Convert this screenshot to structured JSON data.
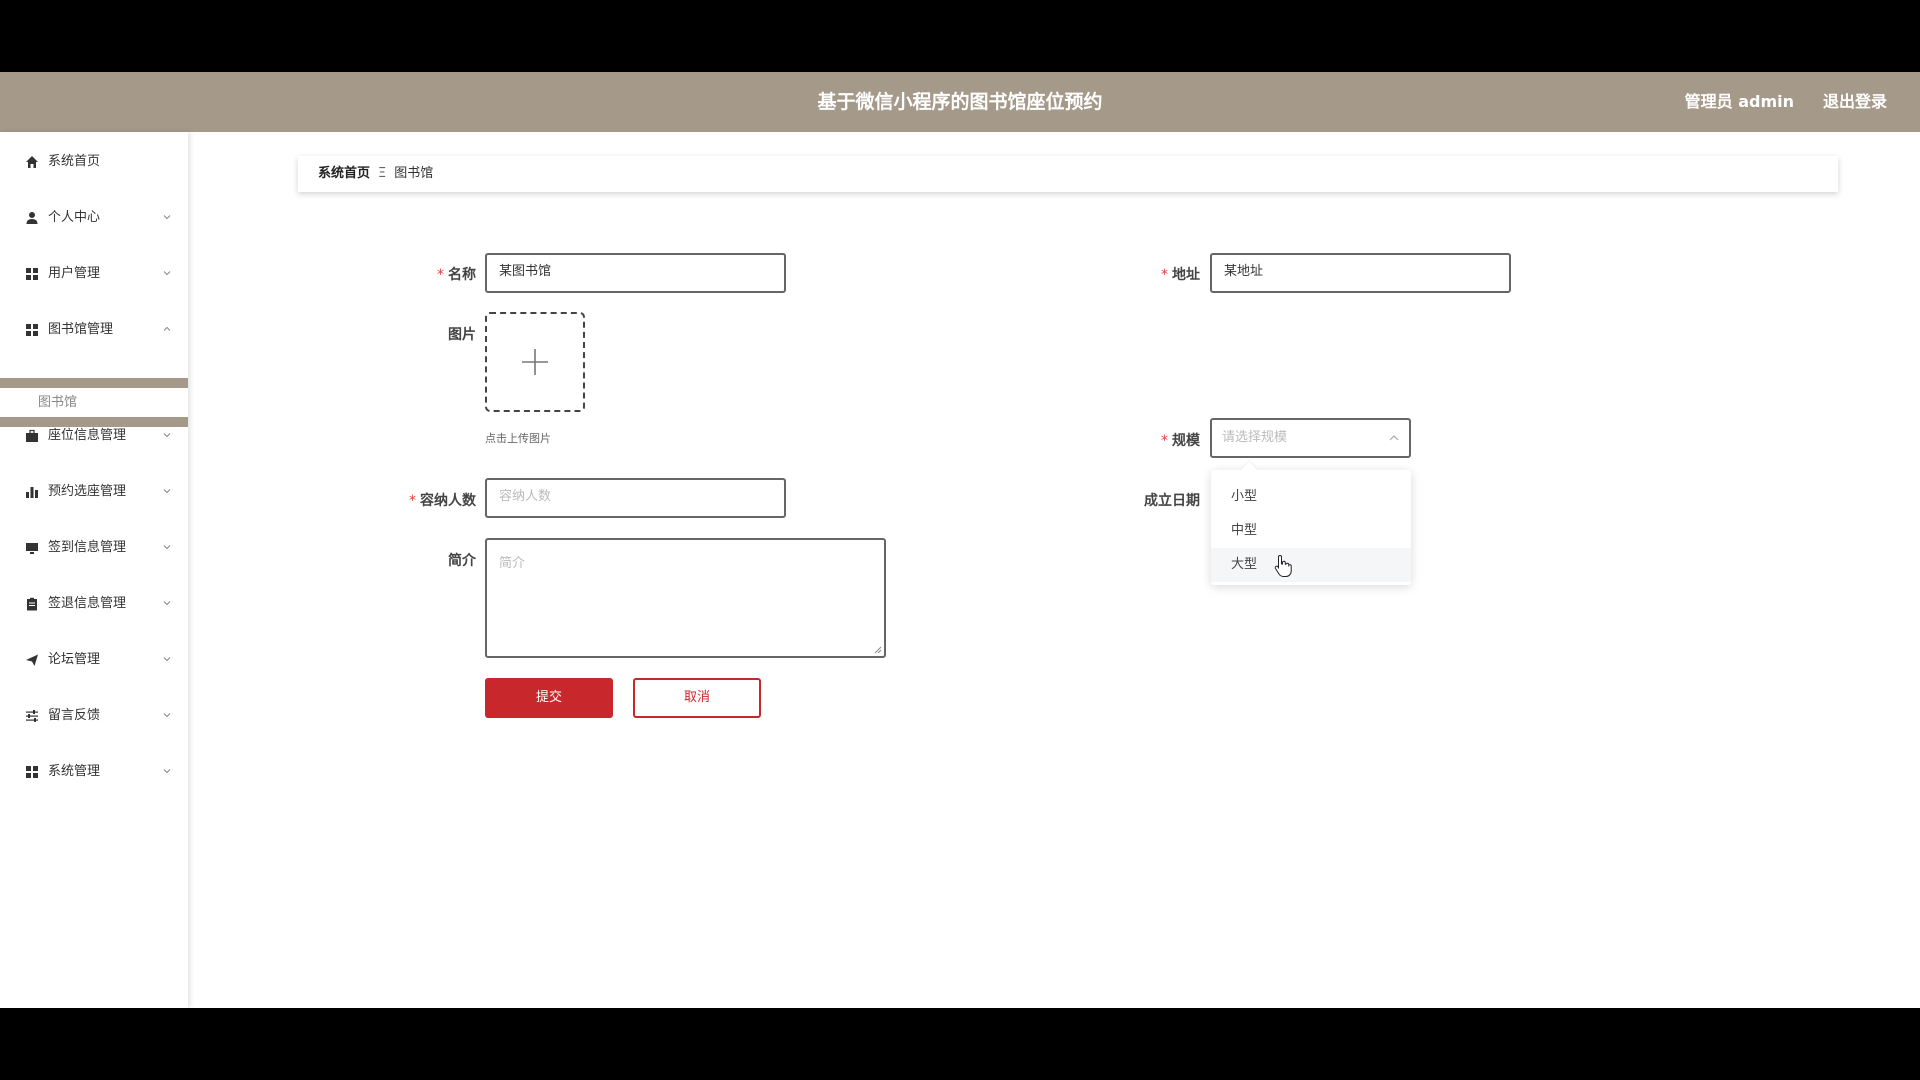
{
  "header": {
    "title": "基于微信小程序的图书馆座位预约",
    "user_label": "管理员 admin",
    "logout_label": "退出登录",
    "bg_color": "#a59a8a"
  },
  "sidebar": {
    "items": [
      {
        "label": "系统首页",
        "icon": "home-icon"
      },
      {
        "label": "个人中心",
        "icon": "user-icon"
      },
      {
        "label": "用户管理",
        "icon": "grid-icon"
      },
      {
        "label": "图书馆管理",
        "icon": "grid-icon"
      },
      {
        "label": "座位信息管理",
        "icon": "briefcase-icon"
      },
      {
        "label": "预约选座管理",
        "icon": "bar-chart-icon"
      },
      {
        "label": "签到信息管理",
        "icon": "monitor-icon"
      },
      {
        "label": "签退信息管理",
        "icon": "clipboard-icon"
      },
      {
        "label": "论坛管理",
        "icon": "send-icon"
      },
      {
        "label": "留言反馈",
        "icon": "sliders-icon"
      },
      {
        "label": "系统管理",
        "icon": "grid-icon"
      }
    ],
    "submenu_item": "图书馆"
  },
  "breadcrumb": {
    "home": "系统首页",
    "separator": "Ξ",
    "current": "图书馆"
  },
  "form": {
    "name_label": "名称",
    "name_value": "某图书馆",
    "address_label": "地址",
    "address_value": "某地址",
    "image_label": "图片",
    "upload_hint": "点击上传图片",
    "scale_label": "规模",
    "scale_placeholder": "请选择规模",
    "scale_options": [
      "小型",
      "中型",
      "大型"
    ],
    "capacity_label": "容纳人数",
    "capacity_placeholder": "容纳人数",
    "established_label": "成立日期",
    "intro_label": "简介",
    "intro_placeholder": "简介",
    "submit_label": "提交",
    "cancel_label": "取消",
    "accent_color": "#c8282b"
  }
}
